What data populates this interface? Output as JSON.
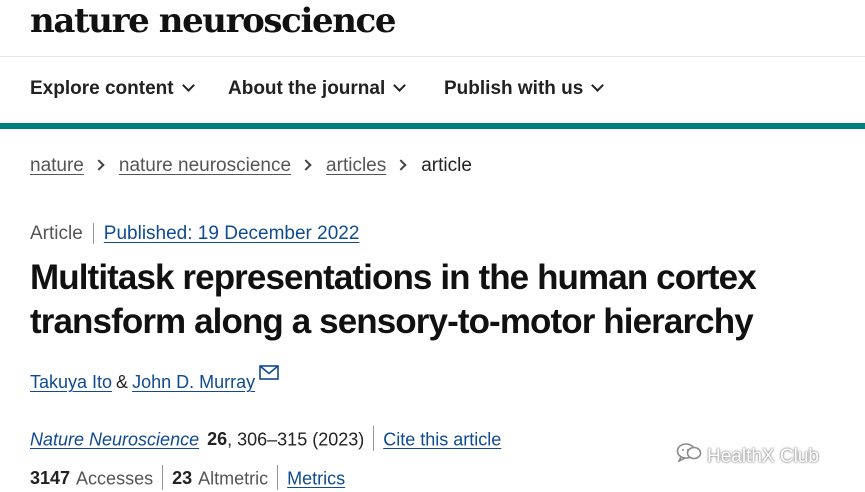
{
  "site": {
    "logo": "nature neuroscience"
  },
  "nav": {
    "items": [
      "Explore content",
      "About the journal",
      "Publish with us"
    ]
  },
  "breadcrumb": {
    "links": [
      "nature",
      "nature neuroscience",
      "articles"
    ],
    "current": "article"
  },
  "meta": {
    "type": "Article",
    "published": "Published: 19 December 2022"
  },
  "article": {
    "title_line1": "Multitask representations in the human cortex",
    "title_line2": "transform along a sensory-to-motor hierarchy",
    "authors": [
      "Takuya Ito",
      "John D. Murray"
    ],
    "author_separator": "&"
  },
  "citation": {
    "journal": "Nature Neuroscience",
    "volume": "26",
    "pages_year": ", 306–315 (2023)",
    "cite_link": "Cite this article"
  },
  "metrics": {
    "accesses_count": "3147",
    "accesses_label": "Accesses",
    "altmetric_count": "23",
    "altmetric_label": "Altmetric",
    "metrics_link": "Metrics"
  },
  "watermark": {
    "text": "HealthX Club"
  },
  "colors": {
    "brand_teal": "#007f7f",
    "link_blue": "#0f4b91"
  }
}
